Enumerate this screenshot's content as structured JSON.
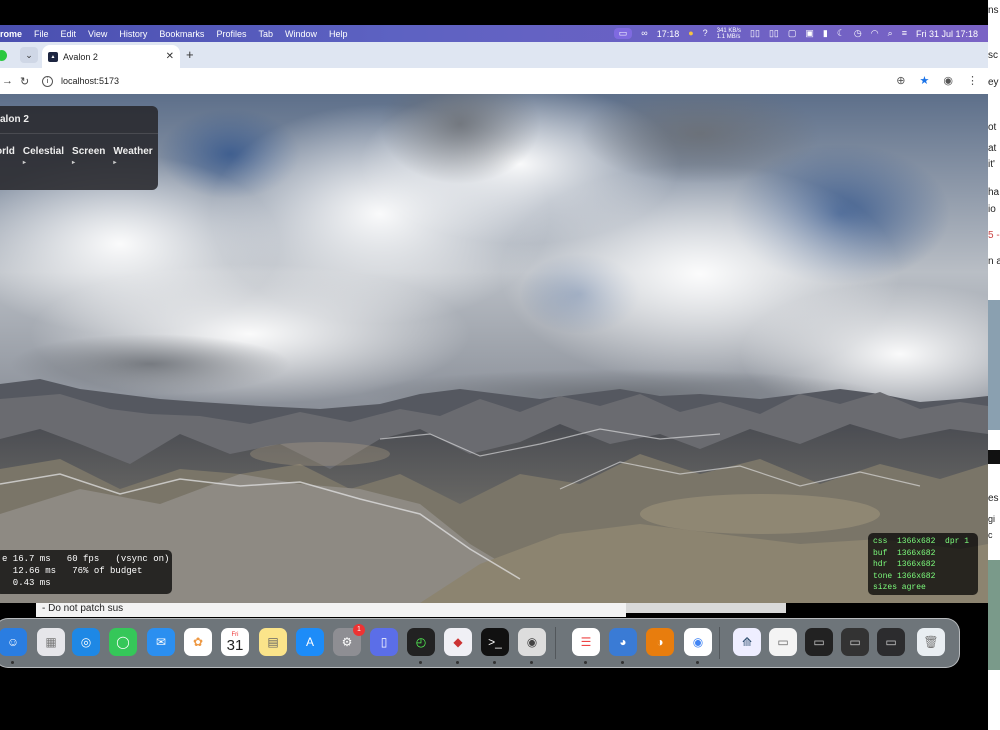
{
  "menubar": {
    "app_name": "Chrome",
    "app_visible": "rome",
    "items": [
      "File",
      "Edit",
      "View",
      "History",
      "Bookmarks",
      "Profiles",
      "Tab",
      "Window",
      "Help"
    ],
    "clock": "17:18",
    "net_up": "341 KB/s",
    "net_down": "1.1 MB/s",
    "datetime": "Fri 31 Jul  17:18"
  },
  "browser": {
    "tab_title": "Avalon 2",
    "url": "localhost:5173"
  },
  "gui": {
    "title_visible": "alon 2",
    "folders": [
      {
        "label": "orld"
      },
      {
        "label": "Celestial"
      },
      {
        "label": "Screen"
      },
      {
        "label": "Weather"
      }
    ],
    "caret": "▸"
  },
  "perf": {
    "line1": "e 16.7 ms   60 fps   (vsync on)",
    "line2": "  12.66 ms   76% of budget",
    "line3": "  0.43 ms"
  },
  "sizes": {
    "line1": "css  1366x682  dpr 1",
    "line2": "buf  1366x682",
    "line3": "hdr  1366x682",
    "line4": "tone 1366x682",
    "line5": "sizes agree"
  },
  "background_window": {
    "text": "- Do not patch sus"
  },
  "right_sliver": [
    "ns",
    "sc",
    "ey",
    "ot",
    "at",
    "it'",
    "ha",
    "io",
    "5 -",
    "n a",
    "es",
    "gi",
    "c"
  ],
  "dock": {
    "calendar_month": "Fri",
    "calendar_day": "31",
    "settings_badge": "1",
    "terminal_glyph": ">_"
  },
  "colors": {
    "menubar": "#5d62c2",
    "chrome_frame": "#dfe6f2",
    "stats_green": "#7CFC7C"
  }
}
